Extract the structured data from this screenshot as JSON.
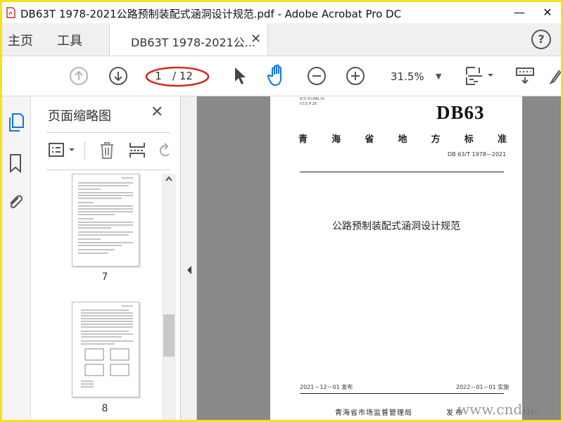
{
  "window": {
    "title": "DB63T 1978-2021公路预制装配式涵洞设计规范.pdf - Adobe Acrobat Pro DC",
    "minimize_glyph": "—",
    "close_glyph": "✕"
  },
  "tabs": {
    "home": "主页",
    "tools": "工具",
    "document": "DB63T 1978-2021公...",
    "close_glyph": "✕",
    "help_glyph": "?"
  },
  "toolbar": {
    "current_page": "1",
    "total_pages": "/ 12",
    "zoom": "31.5%",
    "zoom_arrow": "▼",
    "icons": [
      "page-up-icon",
      "page-down-icon",
      "select-arrow-icon",
      "hand-tool-icon",
      "zoom-out-icon",
      "zoom-in-icon",
      "page-fit-icon",
      "keyboard-icon",
      "pen-icon"
    ]
  },
  "side_rail": {
    "icons": [
      "page-thumbnails-icon",
      "bookmark-icon",
      "attachment-icon"
    ]
  },
  "thumbnail_panel": {
    "title": "页面缩略图",
    "close_glyph": "✕",
    "tool_icons": [
      "thumbnail-options-icon",
      "delete-icon",
      "insert-pages-icon",
      "rotate-icon"
    ],
    "thumbnails": [
      {
        "label": "7"
      },
      {
        "label": "8"
      }
    ]
  },
  "document_page": {
    "ics": "ICS 93.080.10",
    "ccs": "CCS P 28",
    "code": "DB63",
    "province_chars": [
      "青",
      "海",
      "省",
      "地",
      "方",
      "标",
      "准"
    ],
    "standard_number": "DB 63/T 1978—2021",
    "title": "公路预制装配式涵洞设计规范",
    "issue_date": "2021－12－01 发布",
    "implement_date": "2022－01－01 实施",
    "issuer": "青海省市场监督管理局",
    "issuer_suffix": "发 布"
  },
  "watermark": "www.cndac",
  "colors": {
    "frame_border": "#f5e21b",
    "annotation_red": "#d9261c",
    "doc_background": "#898989",
    "hand_tool_blue": "#1473e6"
  }
}
